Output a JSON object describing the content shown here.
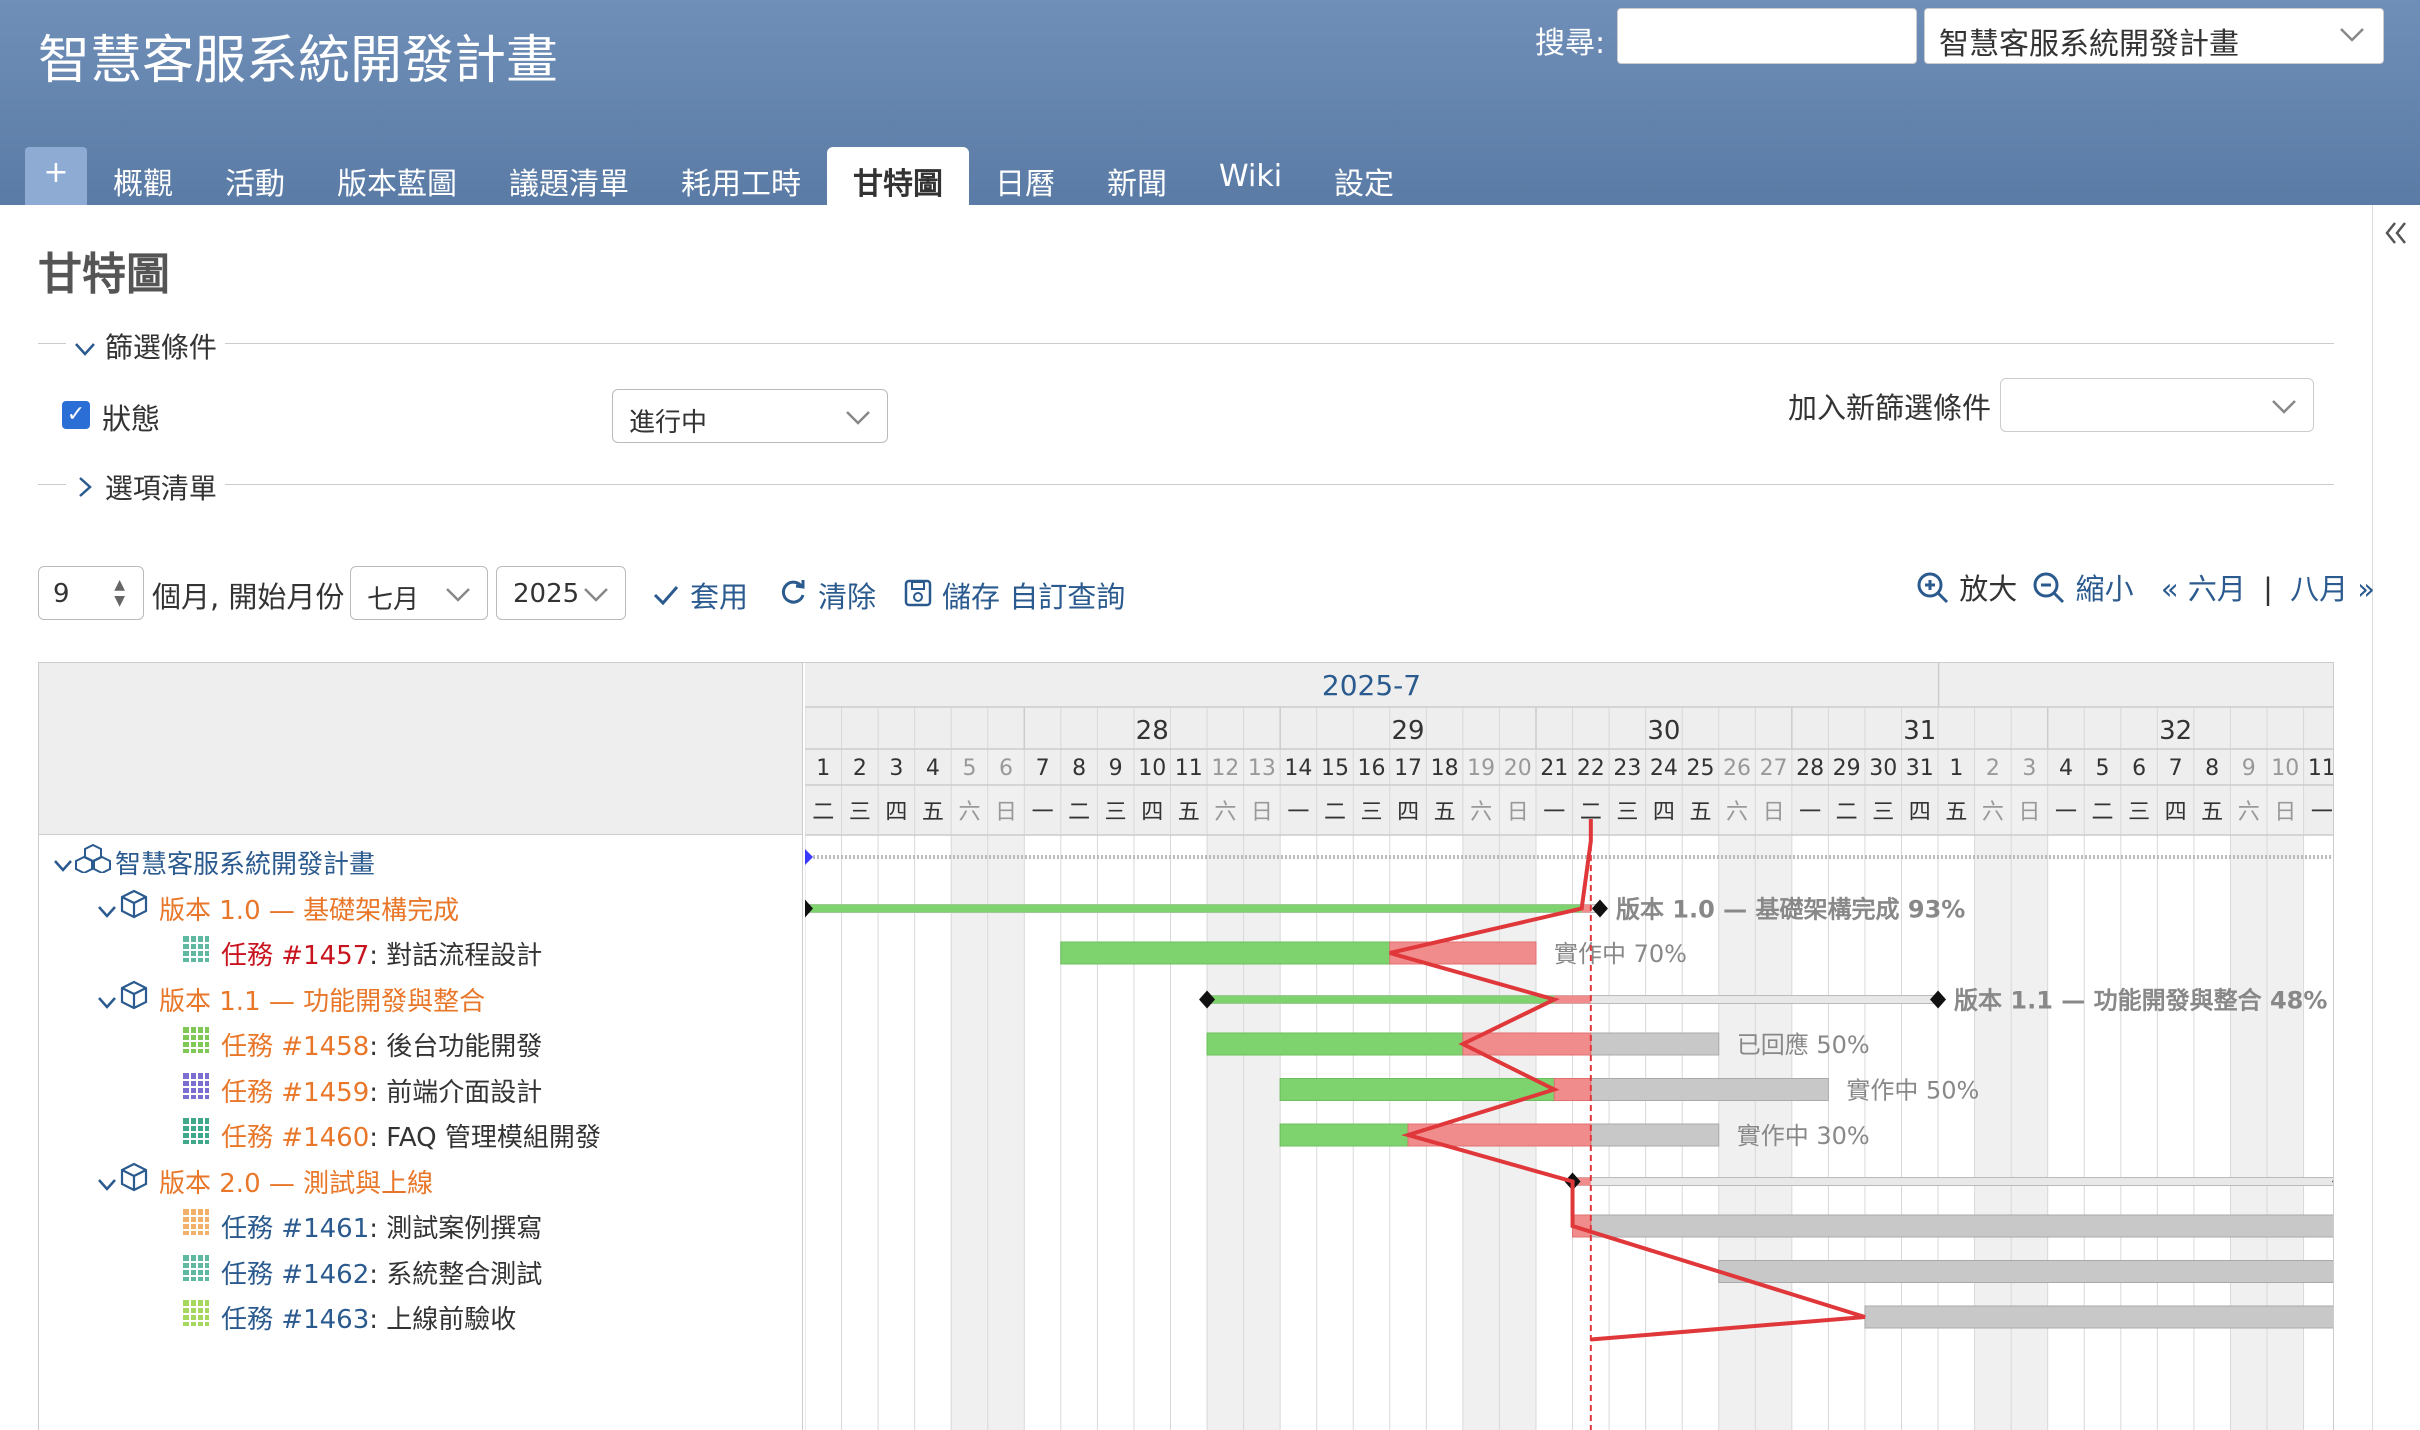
{
  "header": {
    "title": "智慧客服系統開發計畫",
    "search_label": "搜尋:",
    "search_value": "",
    "project_select": "智慧客服系統開發計畫"
  },
  "tabs": [
    {
      "label": "+",
      "active": false
    },
    {
      "label": "概觀",
      "active": false
    },
    {
      "label": "活動",
      "active": false
    },
    {
      "label": "版本藍圖",
      "active": false
    },
    {
      "label": "議題清單",
      "active": false
    },
    {
      "label": "耗用工時",
      "active": false
    },
    {
      "label": "甘特圖",
      "active": true
    },
    {
      "label": "日曆",
      "active": false
    },
    {
      "label": "新聞",
      "active": false
    },
    {
      "label": "Wiki",
      "active": false
    },
    {
      "label": "設定",
      "active": false
    }
  ],
  "page": {
    "title": "甘特圖",
    "filters_legend": "篩選條件",
    "options_legend": "選項清單",
    "status_label": "狀態",
    "status_checked": true,
    "status_value": "進行中",
    "add_filter_label": "加入新篩選條件",
    "add_filter_value": ""
  },
  "controls": {
    "months": "9",
    "months_suffix": "個月, 開始月份",
    "month": "七月",
    "year": "2025",
    "apply": "套用",
    "clear": "清除",
    "save_query": "儲存 自訂查詢",
    "zoom_in": "放大",
    "zoom_out": "縮小",
    "prev_month": "« 六月",
    "separator": "|",
    "next_month": "八月 »"
  },
  "icons": {
    "collapse_sidebar": "double-chevron-left-icon",
    "apply": "checkmark-icon",
    "clear": "refresh-icon",
    "save": "floppy-disk-icon",
    "zoom_in": "zoom-in-icon",
    "zoom_out": "zoom-out-icon"
  },
  "colors": {
    "header_bg": "#6a8bb5",
    "link": "#2a5a8e",
    "version": "#e8772a",
    "done_bar": "#7fd36e",
    "late_bar": "#f08c8c",
    "todo_bar": "#c8c8c8",
    "today_line": "#e0373b",
    "weekend_bg": "#f0f0f0"
  },
  "gantt": {
    "month_label": "2025-7",
    "weeks": [
      "28",
      "29",
      "30",
      "31",
      "32"
    ],
    "days": [
      "1",
      "2",
      "3",
      "4",
      "5",
      "6",
      "7",
      "8",
      "9",
      "10",
      "11",
      "12",
      "13",
      "14",
      "15",
      "16",
      "17",
      "18",
      "19",
      "20",
      "21",
      "22",
      "23",
      "24",
      "25",
      "26",
      "27",
      "28",
      "29",
      "30",
      "31",
      "1",
      "2",
      "3",
      "4",
      "5",
      "6",
      "7",
      "8",
      "9",
      "10",
      "11"
    ],
    "weekdays": [
      "二",
      "三",
      "四",
      "五",
      "六",
      "日",
      "一",
      "二",
      "三",
      "四",
      "五",
      "六",
      "日",
      "一",
      "二",
      "三",
      "四",
      "五",
      "六",
      "日",
      "一",
      "二",
      "三",
      "四",
      "五",
      "六",
      "日",
      "一",
      "二",
      "三",
      "四",
      "五",
      "六",
      "日",
      "一",
      "二",
      "三",
      "四",
      "五",
      "六",
      "日",
      "一"
    ],
    "weekend_index": [
      4,
      5,
      11,
      12,
      18,
      19,
      25,
      26,
      32,
      33,
      39,
      40
    ],
    "today_index": 21.5,
    "rows": [
      {
        "kind": "project",
        "text": "智慧客服系統開發計畫",
        "level": 0,
        "expanded": true,
        "start": 0,
        "end": 42,
        "done": 0,
        "label": ""
      },
      {
        "kind": "version",
        "text": "版本 1.0 — 基礎架構完成",
        "level": 1,
        "expanded": true,
        "start": 0,
        "end": 21.75,
        "done": 21.25,
        "label": "版本 1.0 — 基礎架構完成 93%"
      },
      {
        "kind": "issue",
        "tracker": "任務",
        "id": "#1457",
        "title": "對話流程設計",
        "idclass": "task-red",
        "icon_color": "#5fb8a0",
        "start": 7,
        "end": 20,
        "done": 16,
        "label": "實作中 70%"
      },
      {
        "kind": "version",
        "text": "版本 1.1 — 功能開發與整合",
        "level": 1,
        "expanded": true,
        "start": 11,
        "end": 31,
        "done": 20.5,
        "label": "版本 1.1 — 功能開發與整合 48%"
      },
      {
        "kind": "issue",
        "tracker": "任務",
        "id": "#1458",
        "title": "後台功能開發",
        "idclass": "task-orange",
        "icon_color": "#7fc855",
        "start": 11,
        "end": 25,
        "done": 18,
        "label": "已回應 50%"
      },
      {
        "kind": "issue",
        "tracker": "任務",
        "id": "#1459",
        "title": "前端介面設計",
        "idclass": "task-orange",
        "icon_color": "#7a6fd0",
        "start": 13,
        "end": 28,
        "done": 20.5,
        "label": "實作中 50%"
      },
      {
        "kind": "issue",
        "tracker": "任務",
        "id": "#1460",
        "title": "FAQ 管理模組開發",
        "idclass": "task-orange",
        "icon_color": "#3fa88a",
        "start": 13,
        "end": 25,
        "done": 16.5,
        "label": "實作中 30%"
      },
      {
        "kind": "version",
        "text": "版本 2.0 — 測試與上線",
        "level": 1,
        "expanded": true,
        "start": 21,
        "end": 42,
        "done": 21,
        "label": ""
      },
      {
        "kind": "issue",
        "tracker": "任務",
        "id": "#1461",
        "title": "測試案例撰寫",
        "idclass": "task-blue",
        "icon_color": "#f2b06a",
        "start": 21,
        "end": 42,
        "done": 21,
        "label": ""
      },
      {
        "kind": "issue",
        "tracker": "任務",
        "id": "#1462",
        "title": "系統整合測試",
        "idclass": "task-blue",
        "icon_color": "#5fb8a0",
        "start": 25,
        "end": 42,
        "done": 25,
        "label": ""
      },
      {
        "kind": "issue",
        "tracker": "任務",
        "id": "#1463",
        "title": "上線前驗收",
        "idclass": "task-blue",
        "icon_color": "#a6d860",
        "start": 29,
        "end": 42,
        "done": 29,
        "label": ""
      }
    ]
  }
}
